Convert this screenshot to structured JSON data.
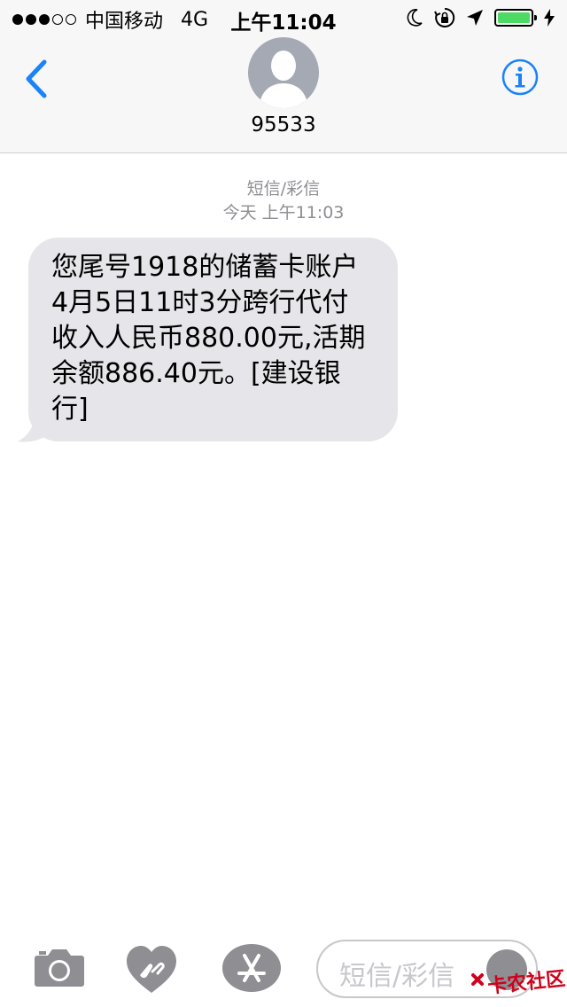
{
  "status_bar": {
    "signal_filled": 3,
    "signal_total": 5,
    "carrier": "中国移动",
    "network": "4G",
    "time": "上午11:04",
    "battery_color": "#4cd964",
    "icons": [
      "moon-icon",
      "orientation-lock-icon",
      "location-arrow-icon",
      "battery-icon",
      "charging-bolt-icon"
    ]
  },
  "nav": {
    "contact": "95533",
    "accent_color": "#1a82fb",
    "icons": [
      "back-chevron-icon",
      "avatar-silhouette-icon",
      "info-icon"
    ]
  },
  "thread": {
    "message_type": "短信/彩信",
    "timestamp": "今天 上午11:03",
    "messages": [
      {
        "from": "contact",
        "text": "您尾号1918的储蓄卡账户4月5日11时3分跨行代付收入人民币880.00元,活期余额886.40元。[建设银行]"
      }
    ]
  },
  "compose": {
    "placeholder": "短信/彩信",
    "icons": [
      "camera-icon",
      "digital-touch-icon",
      "app-store-icon",
      "microphone-icon"
    ]
  },
  "watermark": {
    "text": "卡农社区",
    "color": "#d0021b"
  }
}
